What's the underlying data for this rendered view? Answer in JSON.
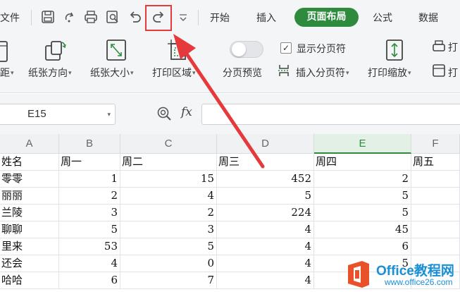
{
  "tabbar": {
    "file_menu": "文件",
    "tabs": [
      {
        "label": "开始"
      },
      {
        "label": "插入"
      },
      {
        "label": "页面布局"
      },
      {
        "label": "公式"
      },
      {
        "label": "数据"
      }
    ],
    "active_tab": "页面布局",
    "quick_access": [
      "save-icon",
      "redo-format-icon",
      "print-icon",
      "print-preview-icon",
      "undo-icon",
      "redo-icon",
      "more-chevron-icon"
    ]
  },
  "ribbon": {
    "margins_fragment": "距",
    "orientation": "纸张方向",
    "paper_size": "纸张大小",
    "print_area": "打印区域",
    "page_break_preview": "分页预览",
    "show_page_breaks": "显示分页符",
    "show_page_breaks_checked": true,
    "insert_page_break": "插入分页符",
    "print_scale": "打印缩放",
    "right_fragment_1": "打",
    "right_fragment_2": "打"
  },
  "formula_bar": {
    "cell_ref": "E15",
    "fx": "fx",
    "formula": ""
  },
  "grid": {
    "columns": [
      "A",
      "B",
      "C",
      "D",
      "E",
      "F"
    ],
    "selected_column": "E",
    "rows": [
      [
        "姓名",
        "周一",
        "周二",
        "周三",
        "周四",
        "周五"
      ],
      [
        "零零",
        "1",
        "15",
        "452",
        "2",
        ""
      ],
      [
        "丽丽",
        "2",
        "4",
        "5",
        "5",
        ""
      ],
      [
        "兰陵",
        "3",
        "2",
        "224",
        "5",
        ""
      ],
      [
        "聊聊",
        "5",
        "3",
        "4",
        "45",
        ""
      ],
      [
        "里来",
        "53",
        "5",
        "4",
        "6",
        ""
      ],
      [
        "还会",
        "4",
        "0",
        "4",
        "5",
        ""
      ],
      [
        "哈哈",
        "6",
        "7",
        "4",
        "",
        ""
      ]
    ]
  },
  "annotation": {
    "highlight_color": "#e5393c",
    "target": "redo-icon"
  },
  "watermark": {
    "brand": "Office教程网",
    "site": "www.office26.com"
  },
  "colors": {
    "accent_green": "#2e8b3e",
    "annotation_red": "#e5393c",
    "watermark_blue": "#1a8fd6"
  }
}
